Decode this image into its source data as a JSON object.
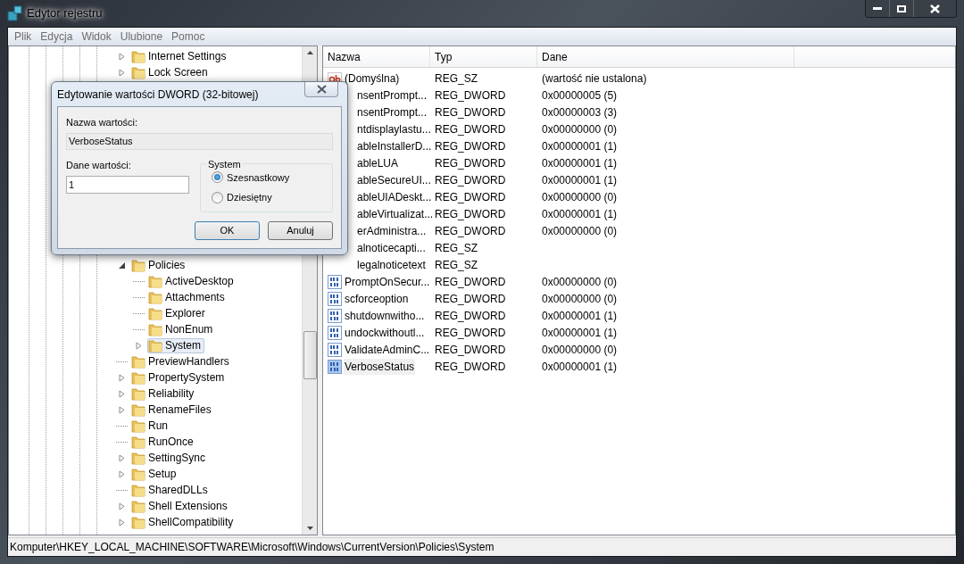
{
  "window": {
    "title": "Edytor rejestru"
  },
  "menu": [
    "Plik",
    "Edycja",
    "Widok",
    "Ulubione",
    "Pomoc"
  ],
  "tree": {
    "top_items": [
      {
        "label": "Internet Settings",
        "expandable": true,
        "expanded": false,
        "selected": false
      },
      {
        "label": "Lock Screen",
        "expandable": true,
        "expanded": false,
        "selected": false
      }
    ],
    "items": [
      {
        "label": "Policies",
        "expandable": true,
        "expanded": true,
        "selected": false,
        "children": [
          {
            "label": "ActiveDesktop",
            "expandable": false,
            "expanded": false,
            "selected": false
          },
          {
            "label": "Attachments",
            "expandable": false,
            "expanded": false,
            "selected": false
          },
          {
            "label": "Explorer",
            "expandable": false,
            "expanded": false,
            "selected": false
          },
          {
            "label": "NonEnum",
            "expandable": false,
            "expanded": false,
            "selected": false
          },
          {
            "label": "System",
            "expandable": true,
            "expanded": false,
            "selected": true
          }
        ]
      },
      {
        "label": "PreviewHandlers",
        "expandable": false,
        "expanded": false,
        "selected": false
      },
      {
        "label": "PropertySystem",
        "expandable": true,
        "expanded": false,
        "selected": false
      },
      {
        "label": "Reliability",
        "expandable": true,
        "expanded": false,
        "selected": false
      },
      {
        "label": "RenameFiles",
        "expandable": true,
        "expanded": false,
        "selected": false
      },
      {
        "label": "Run",
        "expandable": false,
        "expanded": false,
        "selected": false
      },
      {
        "label": "RunOnce",
        "expandable": false,
        "expanded": false,
        "selected": false
      },
      {
        "label": "SettingSync",
        "expandable": true,
        "expanded": false,
        "selected": false
      },
      {
        "label": "Setup",
        "expandable": true,
        "expanded": false,
        "selected": false
      },
      {
        "label": "SharedDLLs",
        "expandable": false,
        "expanded": false,
        "selected": false
      },
      {
        "label": "Shell Extensions",
        "expandable": true,
        "expanded": false,
        "selected": false
      },
      {
        "label": "ShellCompatibility",
        "expandable": true,
        "expanded": false,
        "selected": false
      }
    ]
  },
  "list": {
    "columns": [
      "Nazwa",
      "Typ",
      "Dane"
    ],
    "rows": [
      {
        "kind": "string",
        "name": "(Domyślna)",
        "type": "REG_SZ",
        "data": "(wartość nie ustalona)",
        "selected": false
      },
      {
        "name": "nsentPrompt...",
        "type": "REG_DWORD",
        "data": "0x00000005 (5)",
        "selected": false
      },
      {
        "name": "nsentPrompt...",
        "type": "REG_DWORD",
        "data": "0x00000003 (3)",
        "selected": false
      },
      {
        "name": "ntdisplaylastu...",
        "type": "REG_DWORD",
        "data": "0x00000000 (0)",
        "selected": false
      },
      {
        "name": "ableInstallerD...",
        "type": "REG_DWORD",
        "data": "0x00000001 (1)",
        "selected": false
      },
      {
        "name": "ableLUA",
        "type": "REG_DWORD",
        "data": "0x00000001 (1)",
        "selected": false
      },
      {
        "name": "ableSecureUI...",
        "type": "REG_DWORD",
        "data": "0x00000001 (1)",
        "selected": false
      },
      {
        "name": "ableUIADeskt...",
        "type": "REG_DWORD",
        "data": "0x00000000 (0)",
        "selected": false
      },
      {
        "name": "ableVirtualizat...",
        "type": "REG_DWORD",
        "data": "0x00000001 (1)",
        "selected": false
      },
      {
        "name": "erAdministra...",
        "type": "REG_DWORD",
        "data": "0x00000000 (0)",
        "selected": false
      },
      {
        "name": "alnoticecapti...",
        "type": "REG_SZ",
        "selected": false
      },
      {
        "name": "legalnoticetext",
        "type": "REG_SZ",
        "selected": false
      },
      {
        "kind": "binary",
        "name": "PromptOnSecur...",
        "type": "REG_DWORD",
        "data": "0x00000000 (0)",
        "selected": false
      },
      {
        "kind": "binary",
        "name": "scforceoption",
        "type": "REG_DWORD",
        "data": "0x00000000 (0)",
        "selected": false
      },
      {
        "kind": "binary",
        "name": "shutdownwitho...",
        "type": "REG_DWORD",
        "data": "0x00000001 (1)",
        "selected": false
      },
      {
        "kind": "binary",
        "name": "undockwithoutl...",
        "type": "REG_DWORD",
        "data": "0x00000001 (1)",
        "selected": false
      },
      {
        "kind": "binary",
        "name": "ValidateAdminC...",
        "type": "REG_DWORD",
        "data": "0x00000000 (0)",
        "selected": false
      },
      {
        "kind": "binary",
        "name": "VerboseStatus",
        "type": "REG_DWORD",
        "data": "0x00000001 (1)",
        "selected": true
      }
    ]
  },
  "dialog": {
    "title": "Edytowanie wartości DWORD (32-bitowej)",
    "name_label": "Nazwa wartości:",
    "name_value": "VerboseStatus",
    "data_label": "Dane wartości:",
    "data_value": "1",
    "group_title": "System",
    "radios": [
      {
        "label": "Szesnastkowy",
        "selected": true
      },
      {
        "label": "Dziesiętny",
        "selected": false
      }
    ],
    "buttons": [
      "OK",
      "Anuluj"
    ]
  },
  "status_bar": "Komputer\\HKEY_LOCAL_MACHINE\\SOFTWARE\\Microsoft\\Windows\\CurrentVersion\\Policies\\System"
}
